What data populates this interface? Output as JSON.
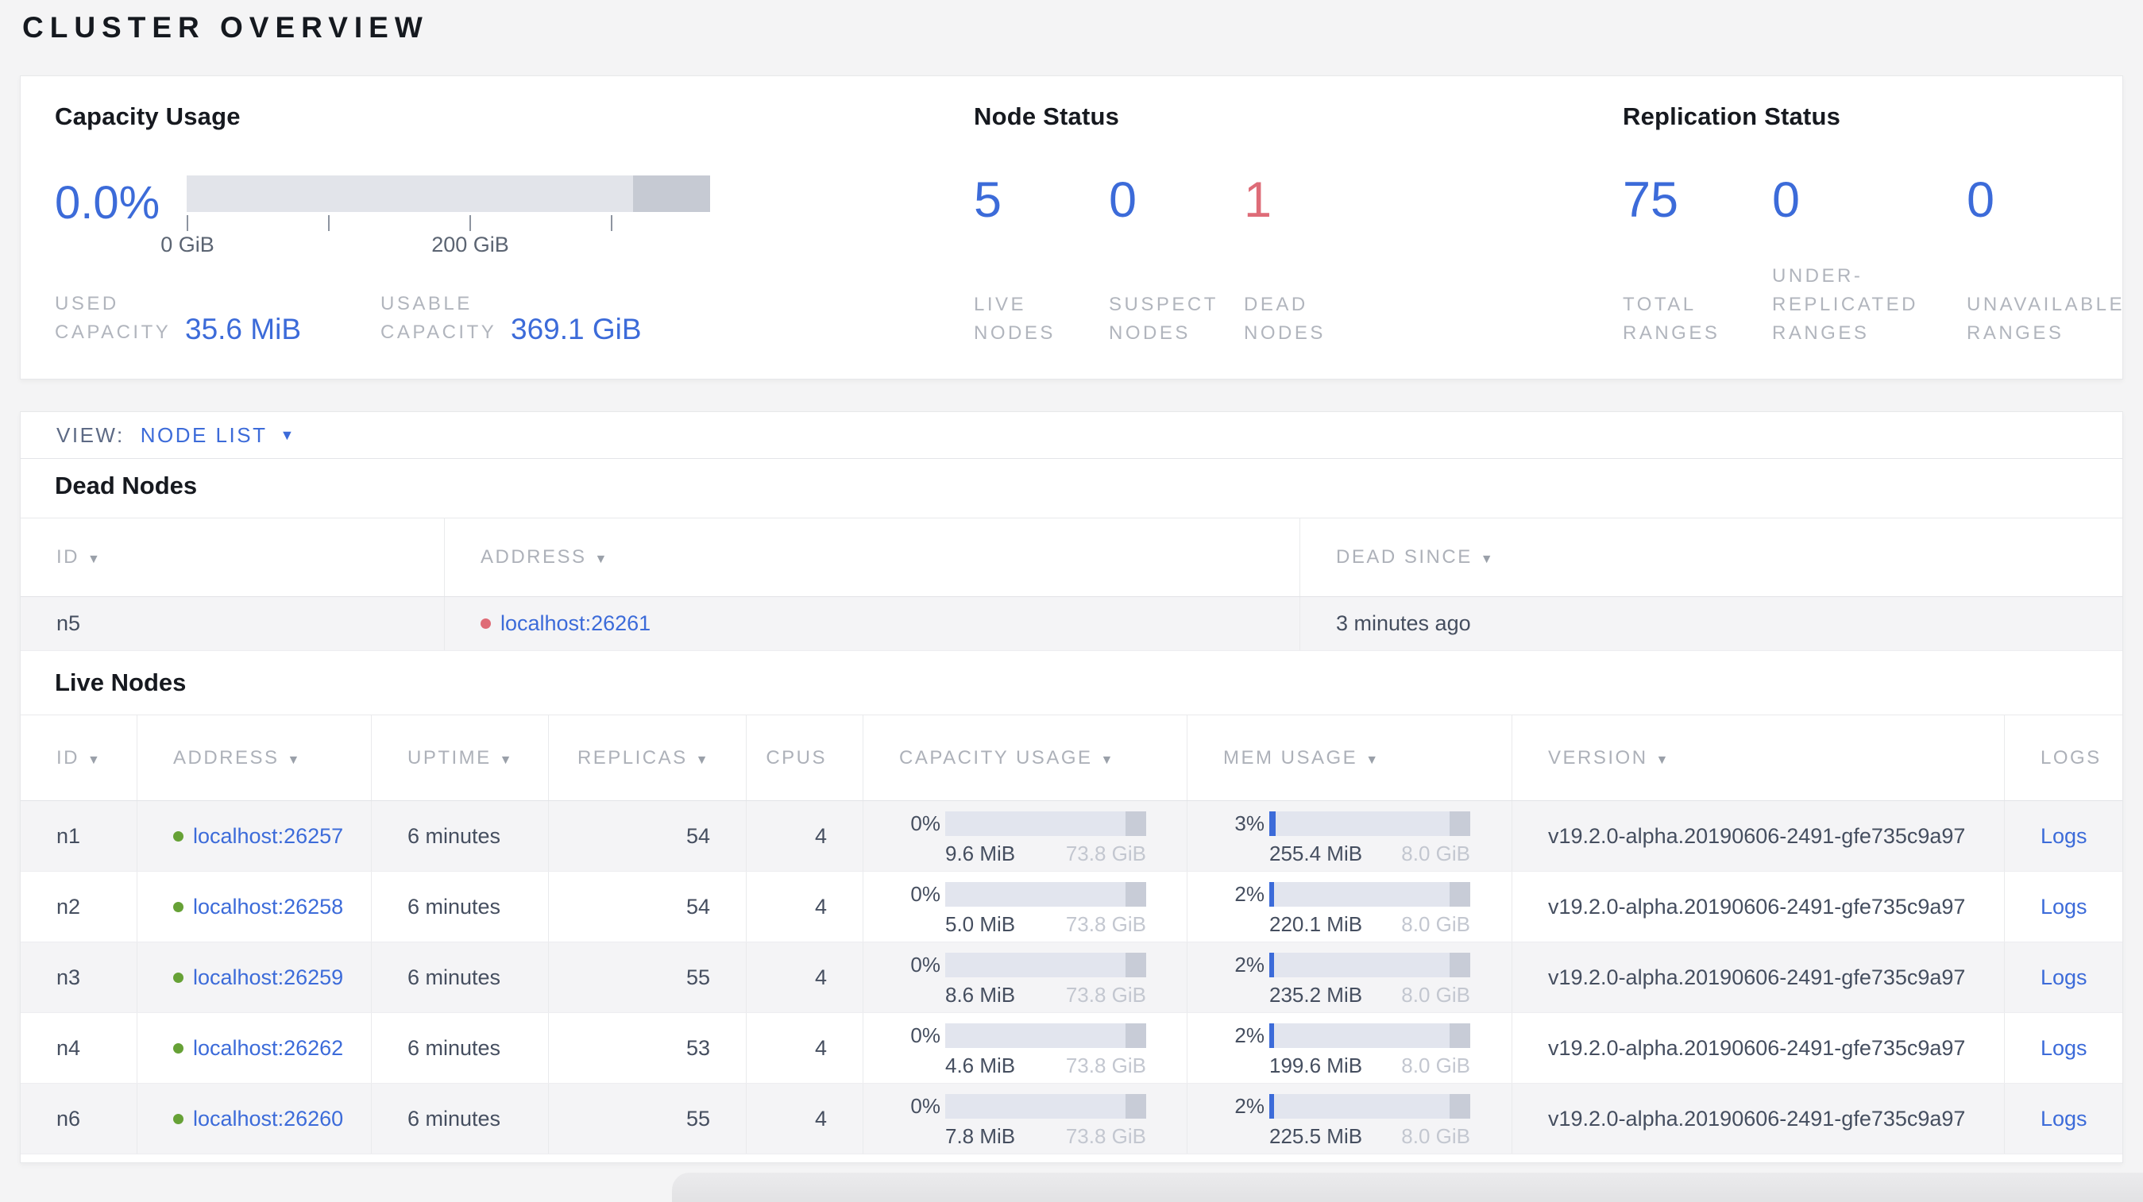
{
  "page_title": "CLUSTER OVERVIEW",
  "capacity": {
    "title": "Capacity Usage",
    "percent": "0.0%",
    "axis_ticks": [
      "0 GiB",
      "200 GiB"
    ],
    "used_label": "USED CAPACITY",
    "used_value": "35.6 MiB",
    "usable_label": "USABLE CAPACITY",
    "usable_value": "369.1 GiB"
  },
  "node_status": {
    "title": "Node Status",
    "stats": [
      {
        "value": "5",
        "label": "LIVE NODES",
        "status": "normal"
      },
      {
        "value": "0",
        "label": "SUSPECT NODES",
        "status": "normal"
      },
      {
        "value": "1",
        "label": "DEAD NODES",
        "status": "danger"
      }
    ]
  },
  "replication": {
    "title": "Replication Status",
    "stats": [
      {
        "value": "75",
        "label": "TOTAL RANGES"
      },
      {
        "value": "0",
        "label": "UNDER-REPLICATED RANGES"
      },
      {
        "value": "0",
        "label": "UNAVAILABLE RANGES"
      }
    ]
  },
  "view_bar": {
    "label": "VIEW:",
    "selected": "NODE LIST",
    "caret": "▼"
  },
  "sort_caret": "▼",
  "dead_nodes": {
    "heading": "Dead Nodes",
    "columns": [
      {
        "label": "ID",
        "key": "id",
        "sortable": true
      },
      {
        "label": "ADDRESS",
        "key": "address",
        "sortable": true
      },
      {
        "label": "DEAD SINCE",
        "key": "dead_since",
        "sortable": true
      }
    ],
    "rows": [
      {
        "id": "n5",
        "address": "localhost:26261",
        "dead_since": "3 minutes ago"
      }
    ]
  },
  "live_nodes": {
    "heading": "Live Nodes",
    "columns": [
      {
        "label": "ID",
        "key": "id",
        "sortable": true
      },
      {
        "label": "ADDRESS",
        "key": "address",
        "sortable": true
      },
      {
        "label": "UPTIME",
        "key": "uptime",
        "sortable": true
      },
      {
        "label": "REPLICAS",
        "key": "replicas",
        "sortable": true,
        "align": "right"
      },
      {
        "label": "CPUS",
        "key": "cpus",
        "sortable": false,
        "align": "right"
      },
      {
        "label": "CAPACITY USAGE",
        "key": "capacity",
        "sortable": true
      },
      {
        "label": "MEM USAGE",
        "key": "memory",
        "sortable": true
      },
      {
        "label": "VERSION",
        "key": "version",
        "sortable": true
      },
      {
        "label": "LOGS",
        "key": "logs",
        "sortable": false
      }
    ],
    "rows": [
      {
        "id": "n1",
        "address": "localhost:26257",
        "uptime": "6 minutes",
        "replicas": "54",
        "cpus": "4",
        "capacity": {
          "percent": "0%",
          "fill_pct": 0,
          "used": "9.6 MiB",
          "total": "73.8 GiB"
        },
        "memory": {
          "percent": "3%",
          "fill_pct": 3,
          "used": "255.4 MiB",
          "total": "8.0 GiB"
        },
        "version": "v19.2.0-alpha.20190606-2491-gfe735c9a97",
        "logs_label": "Logs"
      },
      {
        "id": "n2",
        "address": "localhost:26258",
        "uptime": "6 minutes",
        "replicas": "54",
        "cpus": "4",
        "capacity": {
          "percent": "0%",
          "fill_pct": 0,
          "used": "5.0 MiB",
          "total": "73.8 GiB"
        },
        "memory": {
          "percent": "2%",
          "fill_pct": 2.5,
          "used": "220.1 MiB",
          "total": "8.0 GiB"
        },
        "version": "v19.2.0-alpha.20190606-2491-gfe735c9a97",
        "logs_label": "Logs"
      },
      {
        "id": "n3",
        "address": "localhost:26259",
        "uptime": "6 minutes",
        "replicas": "55",
        "cpus": "4",
        "capacity": {
          "percent": "0%",
          "fill_pct": 0,
          "used": "8.6 MiB",
          "total": "73.8 GiB"
        },
        "memory": {
          "percent": "2%",
          "fill_pct": 2.5,
          "used": "235.2 MiB",
          "total": "8.0 GiB"
        },
        "version": "v19.2.0-alpha.20190606-2491-gfe735c9a97",
        "logs_label": "Logs"
      },
      {
        "id": "n4",
        "address": "localhost:26262",
        "uptime": "6 minutes",
        "replicas": "53",
        "cpus": "4",
        "capacity": {
          "percent": "0%",
          "fill_pct": 0,
          "used": "4.6 MiB",
          "total": "73.8 GiB"
        },
        "memory": {
          "percent": "2%",
          "fill_pct": 2.5,
          "used": "199.6 MiB",
          "total": "8.0 GiB"
        },
        "version": "v19.2.0-alpha.20190606-2491-gfe735c9a97",
        "logs_label": "Logs"
      },
      {
        "id": "n6",
        "address": "localhost:26260",
        "uptime": "6 minutes",
        "replicas": "55",
        "cpus": "4",
        "capacity": {
          "percent": "0%",
          "fill_pct": 0,
          "used": "7.8 MiB",
          "total": "73.8 GiB"
        },
        "memory": {
          "percent": "2%",
          "fill_pct": 2.5,
          "used": "225.5 MiB",
          "total": "8.0 GiB"
        },
        "version": "v19.2.0-alpha.20190606-2491-gfe735c9a97",
        "logs_label": "Logs"
      }
    ]
  },
  "colors": {
    "accent_blue": "#3c6bd9",
    "danger_red": "#de6c78",
    "live_dot_green": "#66a136",
    "dead_dot_red": "#df6b76"
  }
}
